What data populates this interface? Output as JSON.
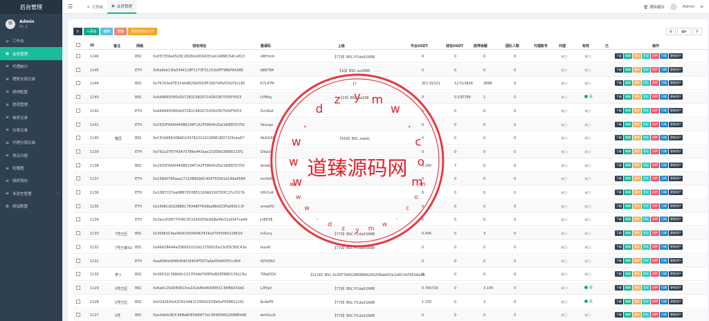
{
  "app": {
    "title": "后台管理"
  },
  "user": {
    "name": "Admin",
    "id": "ID: 1"
  },
  "sidebar": {
    "items": [
      {
        "label": "工作台",
        "icon": "home-icon"
      },
      {
        "label": "会员管理",
        "icon": "user-icon",
        "active": true
      },
      {
        "label": "代理统计",
        "icon": "list-icon"
      },
      {
        "label": "理财交易记录",
        "icon": "list-icon"
      },
      {
        "label": "质押配置",
        "icon": "list-icon"
      },
      {
        "label": "提现管理",
        "icon": "list-icon"
      },
      {
        "label": "抽奖记录",
        "icon": "list-icon"
      },
      {
        "label": "交易记录",
        "icon": "list-icon"
      },
      {
        "label": "代理分销记录",
        "icon": "list-icon"
      },
      {
        "label": "常见问题",
        "icon": "list-icon"
      },
      {
        "label": "轮播图",
        "icon": "list-icon"
      },
      {
        "label": "授权钱包",
        "icon": "list-icon"
      },
      {
        "label": "多语言管理",
        "icon": "list-icon",
        "chevron": true
      },
      {
        "label": "网站配置",
        "icon": "gear-icon"
      }
    ]
  },
  "topbar": {
    "tabs": [
      {
        "label": "工作台",
        "icon": "home-icon"
      },
      {
        "label": "会员管理",
        "icon": "user-icon"
      }
    ],
    "clear_cache": "清除缓存",
    "admin": "Admin"
  },
  "toolbar": {
    "add": "添加",
    "edit": "编辑",
    "delete": "删除",
    "update": "更新钱包USDT"
  },
  "table": {
    "headers": [
      "ID",
      "备注",
      "网络",
      "钱包地址",
      "邀请码",
      "上级",
      "平台USDT",
      "钱包USDT",
      "质押余额",
      "团队人数",
      "代理账号",
      "代理",
      "有效",
      "已",
      "操作"
    ],
    "rows": [
      {
        "id": "1146",
        "note": "",
        "net": "BSC",
        "addr": "0x057356a65d3C28260e0D0A351eCA988CS4Ce813",
        "code": "sNFmnb",
        "parent": "【779】BSC.FCdaili1688",
        "pu": "0",
        "wu": "0",
        "pledge": "0",
        "team": "0",
        "valid": false
      },
      {
        "id": "1145",
        "note": "",
        "net": "ETH",
        "addr": "0x6a8eb13fa0394118F1173F31231b5FF96bF8A36E",
        "code": "kB87RA",
        "parent": "【10】BSC.sa1688",
        "pu": "0",
        "wu": "0",
        "pledge": "0",
        "team": "0",
        "valid": false
      },
      {
        "id": "1144",
        "note": "",
        "net": "BSC",
        "addr": "0x767A3e97E314A9B26b05D9F2AD74Fe5542f3c185",
        "code": "R7L4TM",
        "parent": "【7",
        "pu": "351.92221",
        "wu": "12.513826",
        "pledge": "3888",
        "team": "0",
        "valid": false
      },
      {
        "id": "1143",
        "note": "",
        "net": "BSC",
        "addr": "0xA4A66f2f90d207281C682071439236750SF5053",
        "code": "LYf8kq",
        "parent": "【10】BSC.sa168",
        "pu": "0",
        "wu": "0.535789",
        "pledge": "1",
        "team": "0",
        "valid": true
      },
      {
        "id": "1142",
        "note": "",
        "net": "ETH",
        "addr": "0xA4A66f2f90d207281C682071439236750SF5053",
        "code": "ZvnKaX",
        "parent": "",
        "pu": "0",
        "wu": "0",
        "pledge": "0",
        "team": "0",
        "valid": false
      },
      {
        "id": "1141",
        "note": "",
        "net": "ETH",
        "addr": "0x2503F0A6f440BE194F1A2F09645cEaCb6EB7D750",
        "code": "Xbucgs",
        "parent": "",
        "pu": "0",
        "wu": "0",
        "pledge": "0",
        "team": "0",
        "valid": false
      },
      {
        "id": "1140",
        "note": "糖豆",
        "net": "BSC",
        "addr": "0xC63d96616BAD24378232191389E1BD7339cba67",
        "code": "AbDG4C",
        "parent": "【559】BSC.xiaoG",
        "pu": "0",
        "wu": "0",
        "pledge": "0",
        "team": "0",
        "valid": false
      },
      {
        "id": "1139",
        "note": "",
        "net": "ETH",
        "addr": "0x791a27f5743A70786e443aac23209bC6885115f1",
        "code": "GYaz26",
        "parent": "",
        "pu": "0",
        "wu": "0",
        "pledge": "0",
        "team": "0",
        "valid": false
      },
      {
        "id": "1138",
        "note": "",
        "net": "BSC",
        "addr": "0x2503F0A6f440BE194F1A2F09645cEaCb6EB7D750",
        "code": "dmwtg",
        "parent": "",
        "pu": "0.245",
        "wu": "7",
        "pledge": "0",
        "team": "0",
        "valid": false
      },
      {
        "id": "1137",
        "note": "",
        "net": "ETH",
        "addr": "0x158d076Faaa27132BB28AC404750301b149a65B4",
        "code": "mn4x5E",
        "parent": "",
        "pu": "0",
        "wu": "0",
        "pledge": "0",
        "team": "0",
        "valid": false
      },
      {
        "id": "1136",
        "note": "",
        "net": "ETH",
        "addr": "0x1DB7157ea9B870C0B51100A91927fDfC27cc517b",
        "code": "UHrCa9",
        "parent": "",
        "pu": "0",
        "wu": "0",
        "pledge": "0",
        "team": "0",
        "valid": false
      },
      {
        "id": "1135",
        "note": "",
        "net": "ETH",
        "addr": "0x1696Cd322BB6C7EA48f7409ba88d325Fa069CC3f",
        "code": "xmwDVl",
        "parent": "",
        "pu": "0",
        "wu": "0",
        "pledge": "0",
        "team": "0",
        "valid": false
      },
      {
        "id": "1134",
        "note": "",
        "net": "ETH",
        "addr": "0x3acc82f677436C9722A50D9cA0Ba49c51ef347ce4A",
        "code": "JnEEV8",
        "parent": "",
        "pu": "0",
        "wu": "0",
        "pledge": "0",
        "team": "0",
        "valid": false
      },
      {
        "id": "1133",
        "note": "7号已压",
        "net": "BSC",
        "addr": "0x306Ed14ee9b9c55066967824a070Fd065228619",
        "code": "inZuny",
        "parent": "【779】BSC.FCdaili1688",
        "pu": "0.945",
        "wu": "0",
        "pledge": "3",
        "team": "0",
        "valid": false
      },
      {
        "id": "1132",
        "note": "7号已撑3U",
        "net": "BSC",
        "addr": "0xA6A38A4Aa33692011Od12700025e23cE0CBSC43a",
        "code": "laysiK",
        "parent": "【779】BSC.FCdaili1688",
        "pu": "0",
        "wu": "0",
        "pledge": "0",
        "team": "0",
        "valid": false
      },
      {
        "id": "1131",
        "note": "",
        "net": "ETH",
        "addr": "0xaA0Afa5848d0401E454F5D7aAa50fa005Fcc904",
        "code": "42VQHU",
        "parent": "",
        "pu": "0",
        "wu": "0",
        "pledge": "0",
        "team": "0",
        "valid": false
      },
      {
        "id": "1130",
        "note": "萝卜",
        "net": "BSC",
        "addr": "0x36531C36Bd0c1317D44d700E5dB1EEB8017A1C8a",
        "code": "7WqDQX",
        "parent": "【1116】BSC.0x35F7b6528B9BB42042D8ab0f2b2a6D7bF993Ab99",
        "pu": "0",
        "wu": "0",
        "pledge": "0",
        "team": "0",
        "valid": false
      },
      {
        "id": "1129",
        "note": "0号已压",
        "net": "BSC",
        "addr": "0x6ebC25dDE9913ce161b4fb464DEE1C38fB9150dC",
        "code": "L3FJaV",
        "parent": "【779】BSC.FCdaili1688",
        "pu": "0.760726",
        "wu": "0",
        "pledge": "3.105",
        "team": "0",
        "valid": true
      },
      {
        "id": "1128",
        "note": "0号已压",
        "net": "BSC",
        "addr": "0xD19262fa42D414941C056423f28b5eF65B612c91",
        "code": "8u9eFK",
        "parent": "【779】BSC.FCdaili1688",
        "pu": "1.155",
        "wu": "0",
        "pledge": "3",
        "team": "0",
        "valid": true
      },
      {
        "id": "1127",
        "note": "0号",
        "net": "BSC",
        "addr": "0xe2db6cBDC96BeB0E0A6877eC459009922688E4AE",
        "code": "wmOcy9",
        "parent": "【779】BSC.FCdaili1688",
        "pu": "0",
        "wu": "0",
        "pledge": "0",
        "team": "0",
        "valid": false
      }
    ],
    "status_on": "是",
    "ops": [
      "下级",
      "编辑",
      "删除",
      "提现",
      "质押",
      "归属",
      "更新资产"
    ]
  },
  "watermark": {
    "domain": "www.dzymw.com",
    "name": "道臻源码网"
  },
  "colors": {
    "sidebar": "#2f4050",
    "accent": "#1ab394",
    "stamp": "#e0242b"
  }
}
